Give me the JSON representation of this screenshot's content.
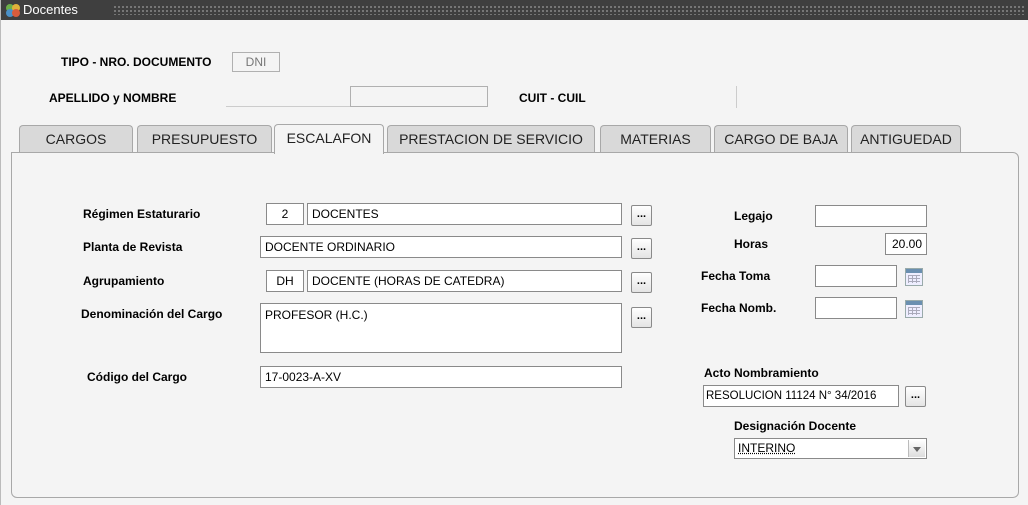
{
  "window": {
    "title": "Docentes"
  },
  "header": {
    "tipo_label": "TIPO - NRO. DOCUMENTO",
    "tipo_value": "DNI",
    "apellido_label": "APELLIDO y NOMBRE",
    "cuit_label": "CUIT - CUIL"
  },
  "tabs": [
    {
      "label": "CARGOS"
    },
    {
      "label": "PRESUPUESTO"
    },
    {
      "label": "ESCALAFON",
      "active": true
    },
    {
      "label": "PRESTACION DE SERVICIO"
    },
    {
      "label": "MATERIAS"
    },
    {
      "label": "CARGO DE BAJA"
    },
    {
      "label": "ANTIGUEDAD"
    }
  ],
  "form": {
    "regimen": {
      "label": "Régimen Estaturario",
      "code": "2",
      "value": "DOCENTES"
    },
    "planta": {
      "label": "Planta de Revista",
      "value": "DOCENTE ORDINARIO"
    },
    "agrupamiento": {
      "label": "Agrupamiento",
      "code": "DH",
      "value": "DOCENTE (HORAS DE CATEDRA)"
    },
    "denominacion": {
      "label": "Denominación del Cargo",
      "value": "PROFESOR (H.C.)"
    },
    "codigo": {
      "label": "Código del Cargo",
      "value": "17-0023-A-XV"
    },
    "legajo": {
      "label": "Legajo",
      "value": ""
    },
    "horas": {
      "label": "Horas",
      "value": "20.00"
    },
    "fecha_toma": {
      "label": "Fecha Toma",
      "value": ""
    },
    "fecha_nomb": {
      "label": "Fecha Nomb.",
      "value": ""
    },
    "acto": {
      "label": "Acto Nombramiento",
      "value": "RESOLUCION 11124 N° 34/2016"
    },
    "designacion": {
      "label": "Designación Docente",
      "value": "INTERINO"
    },
    "lov_button": "..."
  }
}
